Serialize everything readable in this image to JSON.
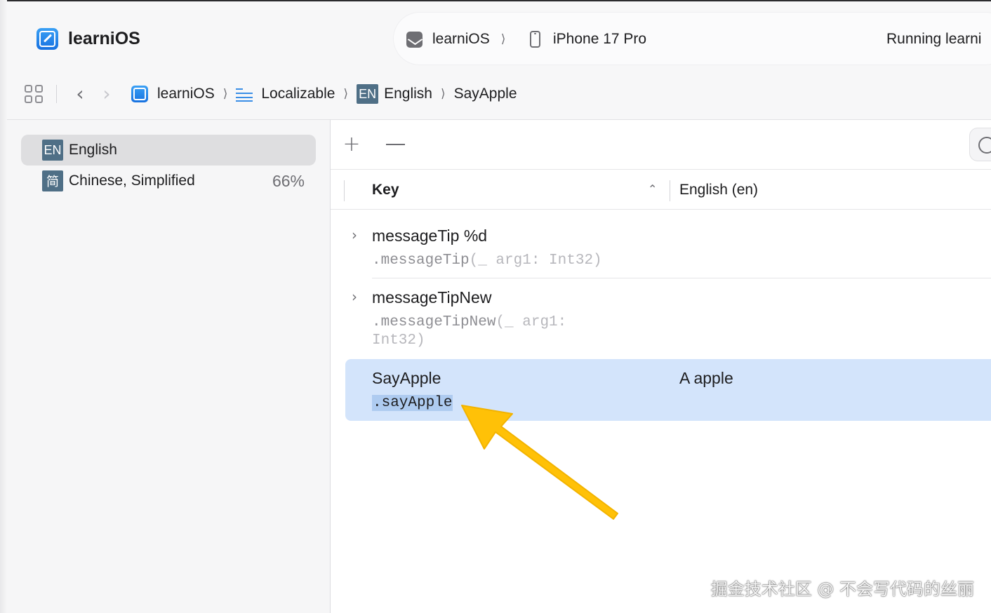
{
  "toolbar": {
    "app_title": "learniOS",
    "scheme": {
      "target": "learniOS",
      "device": "iPhone 17 Pro",
      "status": "Running learni"
    }
  },
  "breadcrumb": {
    "items": [
      "learniOS",
      "Localizable",
      "English",
      "SayApple"
    ],
    "en_badge": "EN"
  },
  "sidebar": {
    "languages": [
      {
        "badge": "EN",
        "name": "English",
        "progress": "",
        "selected": true
      },
      {
        "badge": "简",
        "name": "Chinese, Simplified",
        "progress": "66%",
        "selected": false
      }
    ]
  },
  "table": {
    "add_label": "+",
    "columns": {
      "key": "Key",
      "english": "English (en)"
    },
    "rows": [
      {
        "key": "messageTip %d",
        "symbol_name": ".messageTip",
        "symbol_params": "(_ arg1: Int32)",
        "value": ""
      },
      {
        "key": "messageTipNew",
        "symbol_name": ".messageTipNew",
        "symbol_params_line1": "(_ arg1:",
        "symbol_params_line2": "Int32)",
        "value": ""
      },
      {
        "key": "SayApple",
        "symbol_name": ".sayApple",
        "value": "A apple",
        "selected": true
      }
    ]
  },
  "annotation": {
    "arrow_color": "#FFC107"
  },
  "watermark": "掘金技术社区 @ 不会写代码的丝丽",
  "colors": {
    "accent": "#1771E0",
    "selection": "#D3E4FB",
    "badge": "#4F6F86"
  }
}
